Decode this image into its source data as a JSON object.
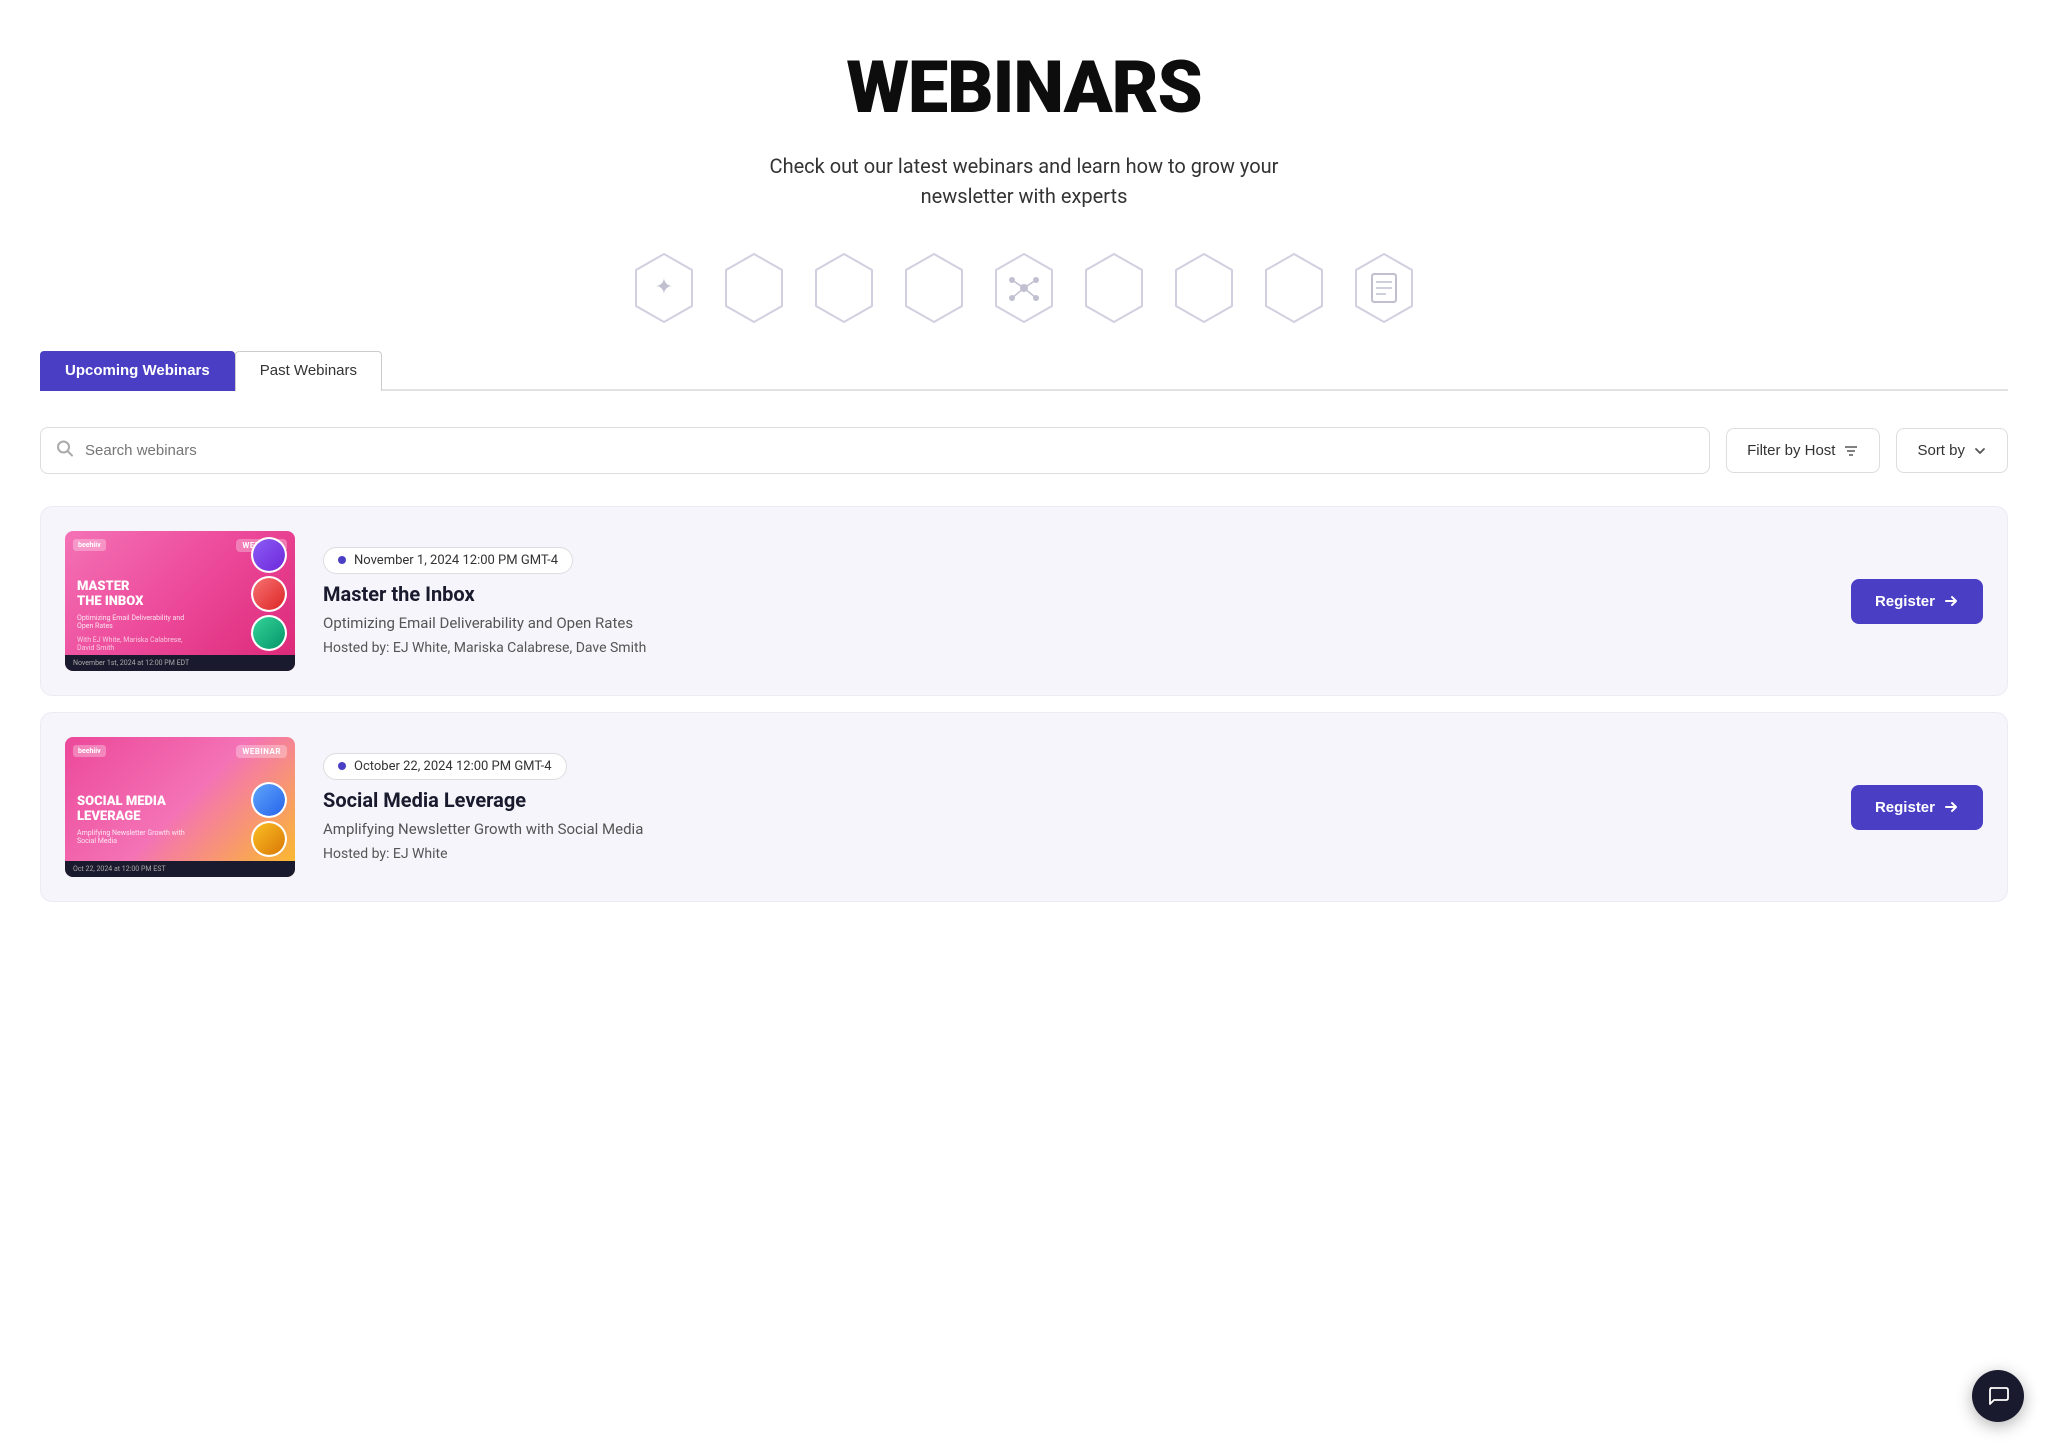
{
  "page": {
    "title": "WEBINARS",
    "subtitle_line1": "Check out our latest webinars and learn how to grow your",
    "subtitle_line2": "newsletter with experts"
  },
  "tabs": [
    {
      "id": "upcoming",
      "label": "Upcoming Webinars",
      "active": true
    },
    {
      "id": "past",
      "label": "Past Webinars",
      "active": false
    }
  ],
  "search": {
    "placeholder": "Search webinars"
  },
  "filter_button": {
    "label": "Filter by Host"
  },
  "sort_button": {
    "label": "Sort by"
  },
  "webinars": [
    {
      "id": "master-inbox",
      "date": "November 1, 2024 12:00 PM GMT-4",
      "title": "Master the Inbox",
      "subtitle": "Optimizing Email Deliverability and Open Rates",
      "hosted_by_label": "Hosted by:",
      "hosts": "EJ White, Mariska Calabrese, Dave Smith",
      "register_label": "Register",
      "thumb_title_line1": "MASTER",
      "thumb_title_line2": "THE INBOX",
      "thumb_subtitle": "Optimizing Email Deliverability and Open Rates",
      "thumb_badge": "WEBINAR",
      "thumb_logo": "beehiiv",
      "thumb_date": "November 1st, 2024 at 12:00 PM EDT"
    },
    {
      "id": "social-media",
      "date": "October 22, 2024 12:00 PM GMT-4",
      "title": "Social Media Leverage",
      "subtitle": "Amplifying Newsletter Growth with Social Media",
      "hosted_by_label": "Hosted by:",
      "hosts": "EJ White",
      "register_label": "Register",
      "thumb_title_line1": "SOCIAL MEDIA",
      "thumb_title_line2": "LEVERAGE",
      "thumb_subtitle": "Amplifying Newsletter Growth with Social Media",
      "thumb_badge": "WEBINAR",
      "thumb_logo": "beehiiv",
      "thumb_date": "Oct 22, 2024 at 12:00 PM EST"
    }
  ],
  "icons": {
    "search": "⌕",
    "filter": "≡",
    "chevron_down": "▾",
    "arrow_right": "→",
    "chat": "💬"
  }
}
